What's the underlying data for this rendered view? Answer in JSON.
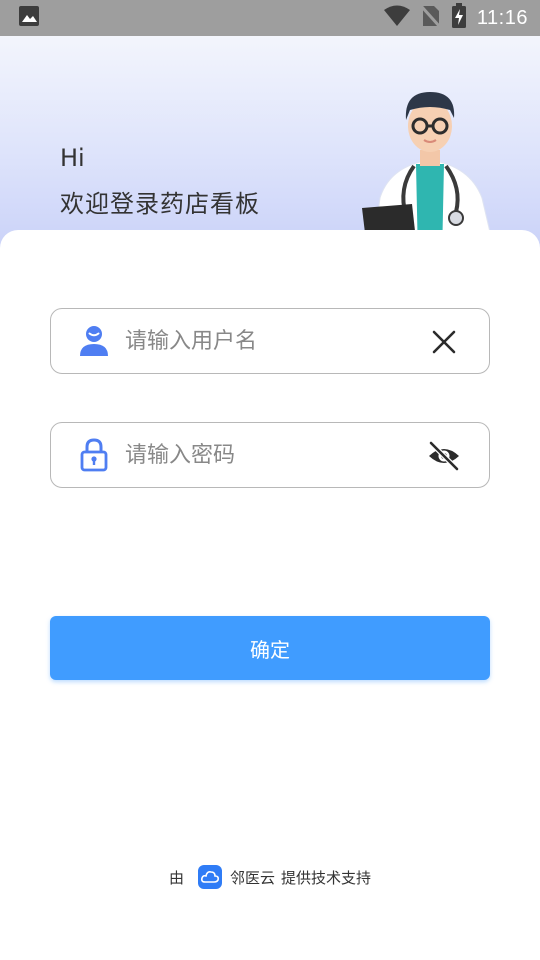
{
  "status_bar": {
    "time": "11:16",
    "icons": [
      "image-icon",
      "wifi-icon",
      "no-sim-icon",
      "battery-charging-icon"
    ]
  },
  "header": {
    "greeting": "Hi",
    "welcome": "欢迎登录药店看板",
    "illustration": "doctor-illustration"
  },
  "login": {
    "username": {
      "placeholder": "请输入用户名",
      "value": "",
      "icon": "user-icon",
      "action_icon": "clear-icon"
    },
    "password": {
      "placeholder": "请输入密码",
      "value": "",
      "icon": "lock-icon",
      "action_icon": "eye-off-icon"
    },
    "submit_label": "确定"
  },
  "footer": {
    "prefix": "由",
    "brand": "邻医云",
    "suffix": "提供技术支持",
    "logo_icon": "cloud-logo-icon"
  },
  "colors": {
    "primary": "#409cff",
    "icon_blue": "#4f7ef2",
    "status_bar": "#9e9e9e"
  }
}
